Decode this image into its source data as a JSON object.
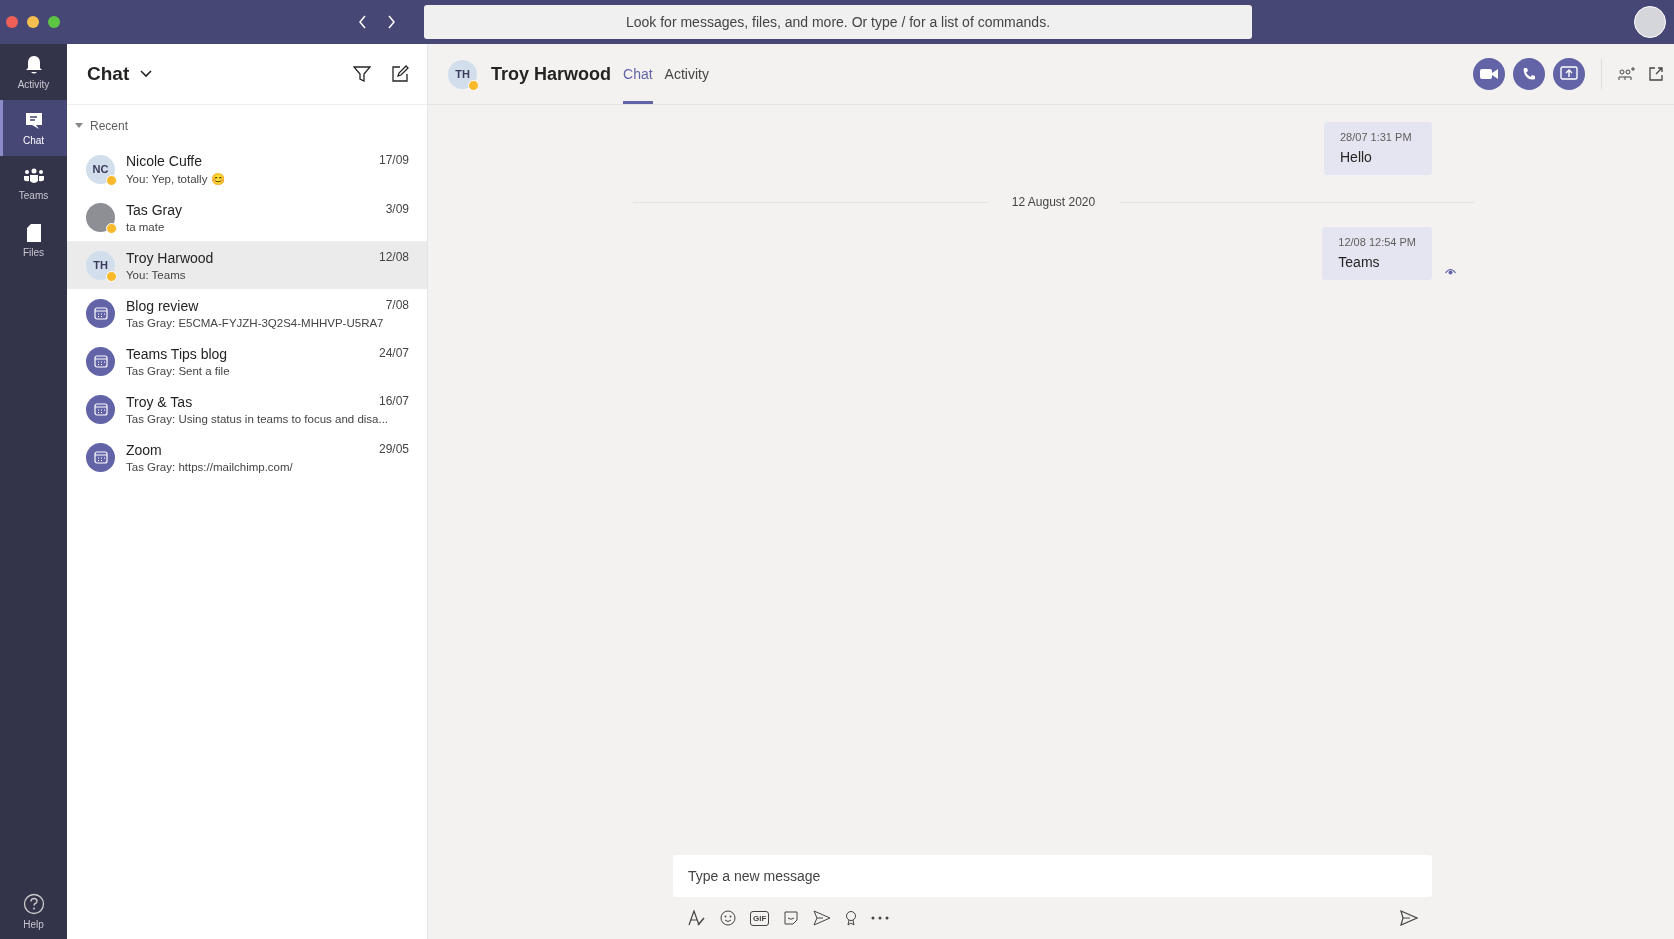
{
  "search": {
    "placeholder": "Look for messages, files, and more. Or type / for a list of commands."
  },
  "rail": [
    {
      "label": "Activity",
      "kind": "bell",
      "selected": false
    },
    {
      "label": "Chat",
      "kind": "chat",
      "selected": true
    },
    {
      "label": "Teams",
      "kind": "teams",
      "selected": false
    },
    {
      "label": "Files",
      "kind": "file",
      "selected": false
    }
  ],
  "help": {
    "label": "Help"
  },
  "list": {
    "title": "Chat",
    "section": "Recent",
    "items": [
      {
        "kind": "person",
        "initials": "NC",
        "away": true,
        "name": "Nicole Cuffe",
        "preview": "You: Yep, totally 😊",
        "date": "17/09",
        "selected": false
      },
      {
        "kind": "photo",
        "away": true,
        "name": "Tas Gray",
        "preview": "ta mate",
        "date": "3/09",
        "selected": false
      },
      {
        "kind": "person",
        "initials": "TH",
        "away": true,
        "name": "Troy Harwood",
        "preview": "You: Teams",
        "date": "12/08",
        "selected": true
      },
      {
        "kind": "meeting",
        "away": false,
        "name": "Blog review",
        "preview": "Tas Gray: E5CMA-FYJZH-3Q2S4-MHHVP-U5RA7",
        "date": "7/08",
        "selected": false
      },
      {
        "kind": "meeting",
        "away": false,
        "name": "Teams Tips blog",
        "preview": "Tas Gray: Sent a file",
        "date": "24/07",
        "selected": false
      },
      {
        "kind": "meeting",
        "away": false,
        "name": "Troy & Tas",
        "preview": "Tas Gray: Using status in teams to focus and disa...",
        "date": "16/07",
        "selected": false
      },
      {
        "kind": "meeting",
        "away": false,
        "name": "Zoom",
        "preview": "Tas Gray: https://mailchimp.com/",
        "date": "29/05",
        "selected": false
      }
    ]
  },
  "conversation": {
    "initials": "TH",
    "away": true,
    "name": "Troy Harwood",
    "tabs": [
      {
        "label": "Chat",
        "selected": true
      },
      {
        "label": "Activity",
        "selected": false
      }
    ],
    "messages": [
      {
        "kind": "message",
        "time": "28/07 1:31 PM",
        "text": "Hello",
        "seen": false
      },
      {
        "kind": "divider",
        "text": "12 August 2020"
      },
      {
        "kind": "message",
        "time": "12/08 12:54 PM",
        "text": "Teams",
        "seen": true
      }
    ],
    "compose": {
      "placeholder": "Type a new message",
      "gif_label": "GIF"
    }
  }
}
